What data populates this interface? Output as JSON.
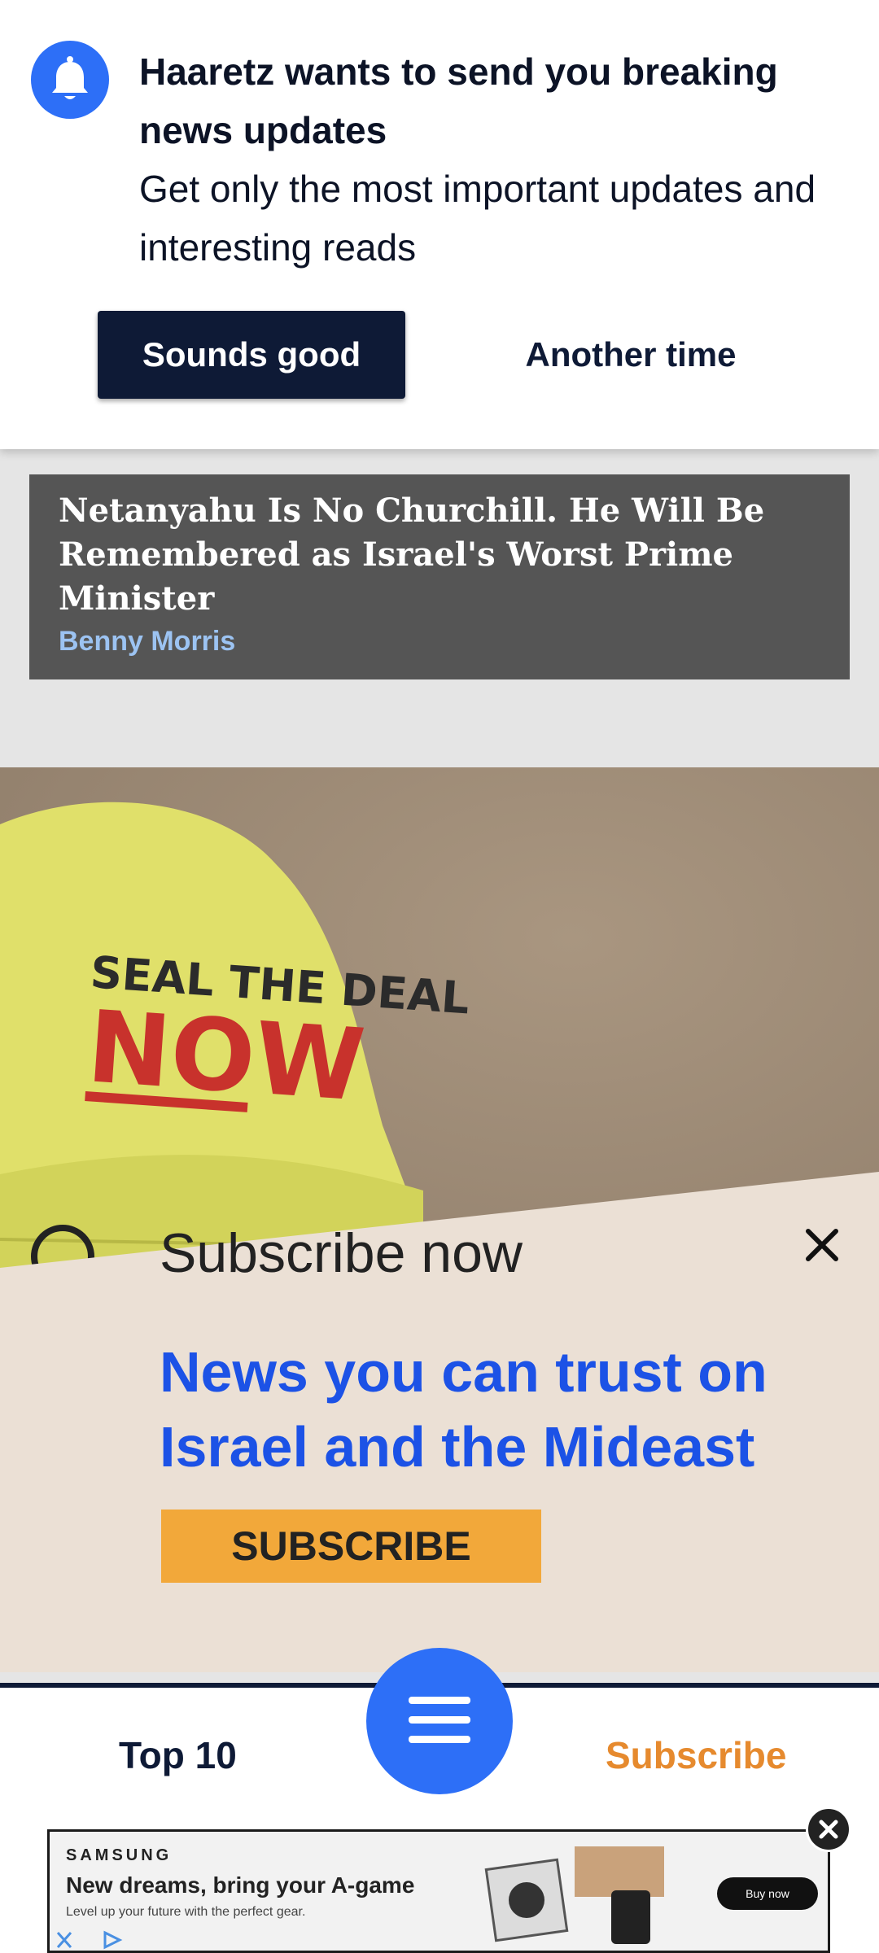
{
  "notification": {
    "icon": "bell-icon",
    "title": "Haaretz wants to send you breaking news updates",
    "body": "Get only the most important updates and interesting reads",
    "accept_label": "Sounds good",
    "decline_label": "Another time"
  },
  "article": {
    "title": "Netanyahu Is No Churchill. He Will Be Remembered as Israel's Worst Prime Minister",
    "author": "Benny Morris"
  },
  "photo": {
    "hat_line1": "SEAL THE DEAL",
    "hat_line2": "NOW"
  },
  "promo": {
    "heading": "Subscribe now",
    "tagline": "News you can trust on Israel and the Mideast",
    "cta_label": "SUBSCRIBE",
    "close_icon": "close-icon"
  },
  "bottom_nav": {
    "left_label": "Top 10",
    "right_label": "Subscribe",
    "menu_icon": "hamburger-menu-icon"
  },
  "ad": {
    "brand": "SAMSUNG",
    "headline": "New dreams, bring your A-game",
    "subline": "Level up your future with the perfect gear.",
    "cta_label": "Buy now"
  },
  "colors": {
    "accent_blue": "#2d6ff7",
    "navy": "#0e1a36",
    "promo_bg": "#ebe0d5",
    "subscribe_orange": "#e68a2e",
    "cta_yellow": "#f2a83a"
  }
}
